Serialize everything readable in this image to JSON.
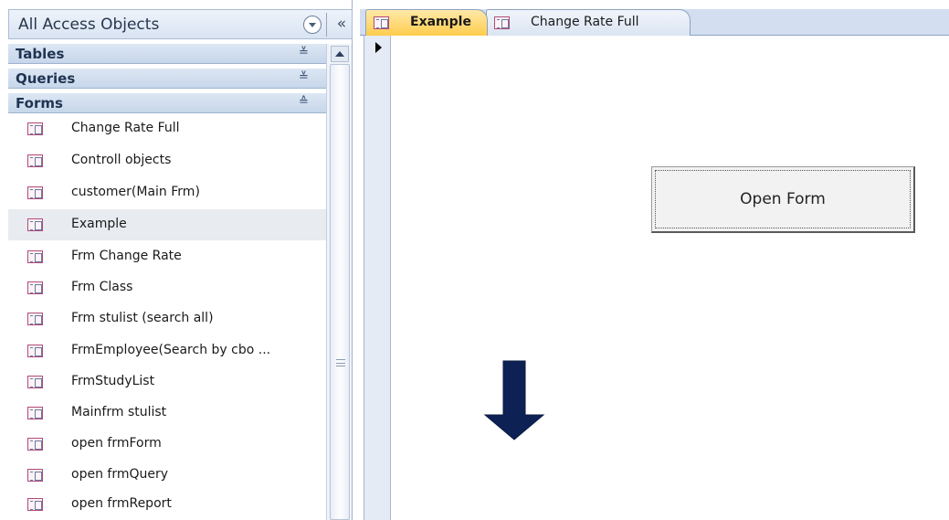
{
  "nav": {
    "title": "All Access Objects",
    "collapse_glyph": "«",
    "groups": [
      {
        "label": "Tables",
        "chevron": "≚"
      },
      {
        "label": "Queries",
        "chevron": "≚"
      },
      {
        "label": "Forms",
        "chevron": "≙"
      }
    ],
    "items": [
      {
        "label": "Change Rate Full"
      },
      {
        "label": "Controll objects"
      },
      {
        "label": "customer(Main Frm)"
      },
      {
        "label": "Example",
        "selected": true
      },
      {
        "label": "Frm Change Rate"
      },
      {
        "label": "Frm Class"
      },
      {
        "label": "Frm stulist (search all)"
      },
      {
        "label": "FrmEmployee(Search  by cbo ..."
      },
      {
        "label": "FrmStudyList"
      },
      {
        "label": "Mainfrm stulist"
      },
      {
        "label": "open frmForm"
      },
      {
        "label": "open frmQuery"
      },
      {
        "label": "open frmReport"
      }
    ]
  },
  "tabs": [
    {
      "label": "Example",
      "active": true
    },
    {
      "label": "Change Rate Full",
      "active": false
    }
  ],
  "form": {
    "button_label": "Open Form"
  },
  "colors": {
    "arrow": "#0d2154",
    "active_tab": "#ffcc4d",
    "icon_border": "#b24b78"
  },
  "icons": {
    "form_object": "form-icon",
    "dropdown": "chevron-down-circle-icon",
    "collapse": "double-chevron-left-icon",
    "record_pointer": "triangle-right-icon",
    "arrow": "down-arrow-icon"
  }
}
